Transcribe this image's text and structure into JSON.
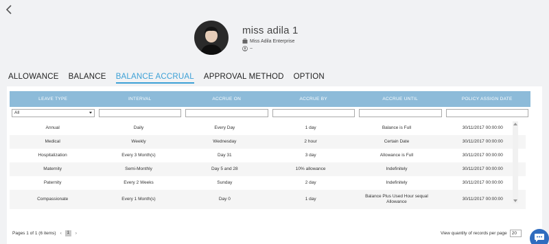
{
  "profile": {
    "name": "miss adila 1",
    "company": "Miss Adila Enterprise",
    "user_detail": "~"
  },
  "tabs": [
    {
      "label": "ALLOWANCE",
      "active": false
    },
    {
      "label": "BALANCE",
      "active": false
    },
    {
      "label": "BALANCE ACCRUAL",
      "active": true
    },
    {
      "label": "APPROVAL METHOD",
      "active": false
    },
    {
      "label": "OPTION",
      "active": false
    }
  ],
  "table": {
    "headers": [
      "LEAVE TYPE",
      "INTERVAL",
      "ACCRUE ON",
      "ACCRUE BY",
      "ACCRUE UNTIL",
      "POLICY ASSIGN DATE"
    ],
    "filter_leave_type": "All",
    "rows": [
      {
        "leave_type": "Annual",
        "interval": "Daily",
        "accrue_on": "Every Day",
        "accrue_by": "1 day",
        "accrue_until": "Balance is Full",
        "policy_assign_date": "30/11/2017 00:00:00"
      },
      {
        "leave_type": "Medical",
        "interval": "Weekly",
        "accrue_on": "Wednesday",
        "accrue_by": "2 hour",
        "accrue_until": "Certain Date",
        "policy_assign_date": "30/11/2017 00:00:00"
      },
      {
        "leave_type": "Hospitalization",
        "interval": "Every 3 Month(s)",
        "accrue_on": "Day 31",
        "accrue_by": "3 day",
        "accrue_until": "Allowance is Full",
        "policy_assign_date": "30/11/2017 00:00:00"
      },
      {
        "leave_type": "Maternity",
        "interval": "Semi-Monthly",
        "accrue_on": "Day 5 and 28",
        "accrue_by": "10% allowance",
        "accrue_until": "Indefinitely",
        "policy_assign_date": "30/11/2017 00:00:00"
      },
      {
        "leave_type": "Paternity",
        "interval": "Every 2 Weeks",
        "accrue_on": "Sunday",
        "accrue_by": "2 day",
        "accrue_until": "Indefinitely",
        "policy_assign_date": "30/11/2017 00:00:00"
      },
      {
        "leave_type": "Compassionate",
        "interval": "Every 1 Month(s)",
        "accrue_on": "Day 0",
        "accrue_by": "1 day",
        "accrue_until": "Balance Plus Used Hour sequal Allowance",
        "policy_assign_date": "30/11/2017 00:00:00"
      }
    ]
  },
  "pager": {
    "summary": "Pages 1 of 1 (6 items)",
    "prev": "‹",
    "current_page": "1",
    "next": "›"
  },
  "page_size": {
    "label": "View quantity of records per page",
    "value": "20"
  },
  "colors": {
    "accent": "#3ba0d6",
    "header_bg": "#8dbbd9",
    "chat_button": "#2f6cbf"
  },
  "icons": {
    "back": "chevron-left-icon",
    "company": "briefcase-icon",
    "user": "user-circle-icon",
    "chat": "chat-bubble-icon"
  }
}
